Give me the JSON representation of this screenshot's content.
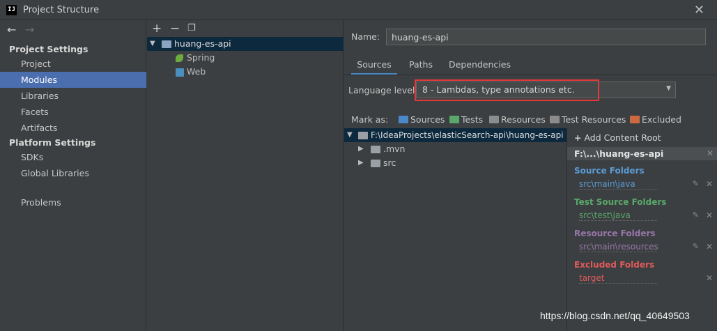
{
  "window": {
    "title": "Project Structure",
    "app_icon": "IJ"
  },
  "nav": {
    "project_settings": "Project Settings",
    "items1": [
      "Project",
      "Modules",
      "Libraries",
      "Facets",
      "Artifacts"
    ],
    "platform_settings": "Platform Settings",
    "items2": [
      "SDKs",
      "Global Libraries"
    ],
    "problems": "Problems",
    "selected": "Modules"
  },
  "modules": {
    "root": "huang-es-api",
    "children": [
      "Spring",
      "Web"
    ]
  },
  "detail": {
    "name_label": "Name:",
    "name_value": "huang-es-api",
    "tabs": [
      "Sources",
      "Paths",
      "Dependencies"
    ],
    "active_tab": "Sources",
    "lang_label": "Language level:",
    "lang_value": "8 - Lambdas, type annotations etc.",
    "mark_as": "Mark as:",
    "mark_buttons": [
      "Sources",
      "Tests",
      "Resources",
      "Test Resources",
      "Excluded"
    ]
  },
  "content_tree": {
    "root": "F:\\IdeaProjects\\elasticSearch-api\\huang-es-api",
    "children": [
      ".mvn",
      "src"
    ]
  },
  "roots": {
    "add": "Add Content Root",
    "header": "F:\\...\\huang-es-api",
    "source_title": "Source Folders",
    "source_path": "src\\main\\java",
    "test_title": "Test Source Folders",
    "test_path": "src\\test\\java",
    "resource_title": "Resource Folders",
    "resource_path": "src\\main\\resources",
    "excluded_title": "Excluded Folders",
    "excluded_path": "target"
  },
  "colors": {
    "sources": "#5b9bd5",
    "tests": "#59a869",
    "resources": "#9876aa",
    "excluded": "#e05a5a"
  },
  "watermark": "https://blog.csdn.net/qq_40649503"
}
